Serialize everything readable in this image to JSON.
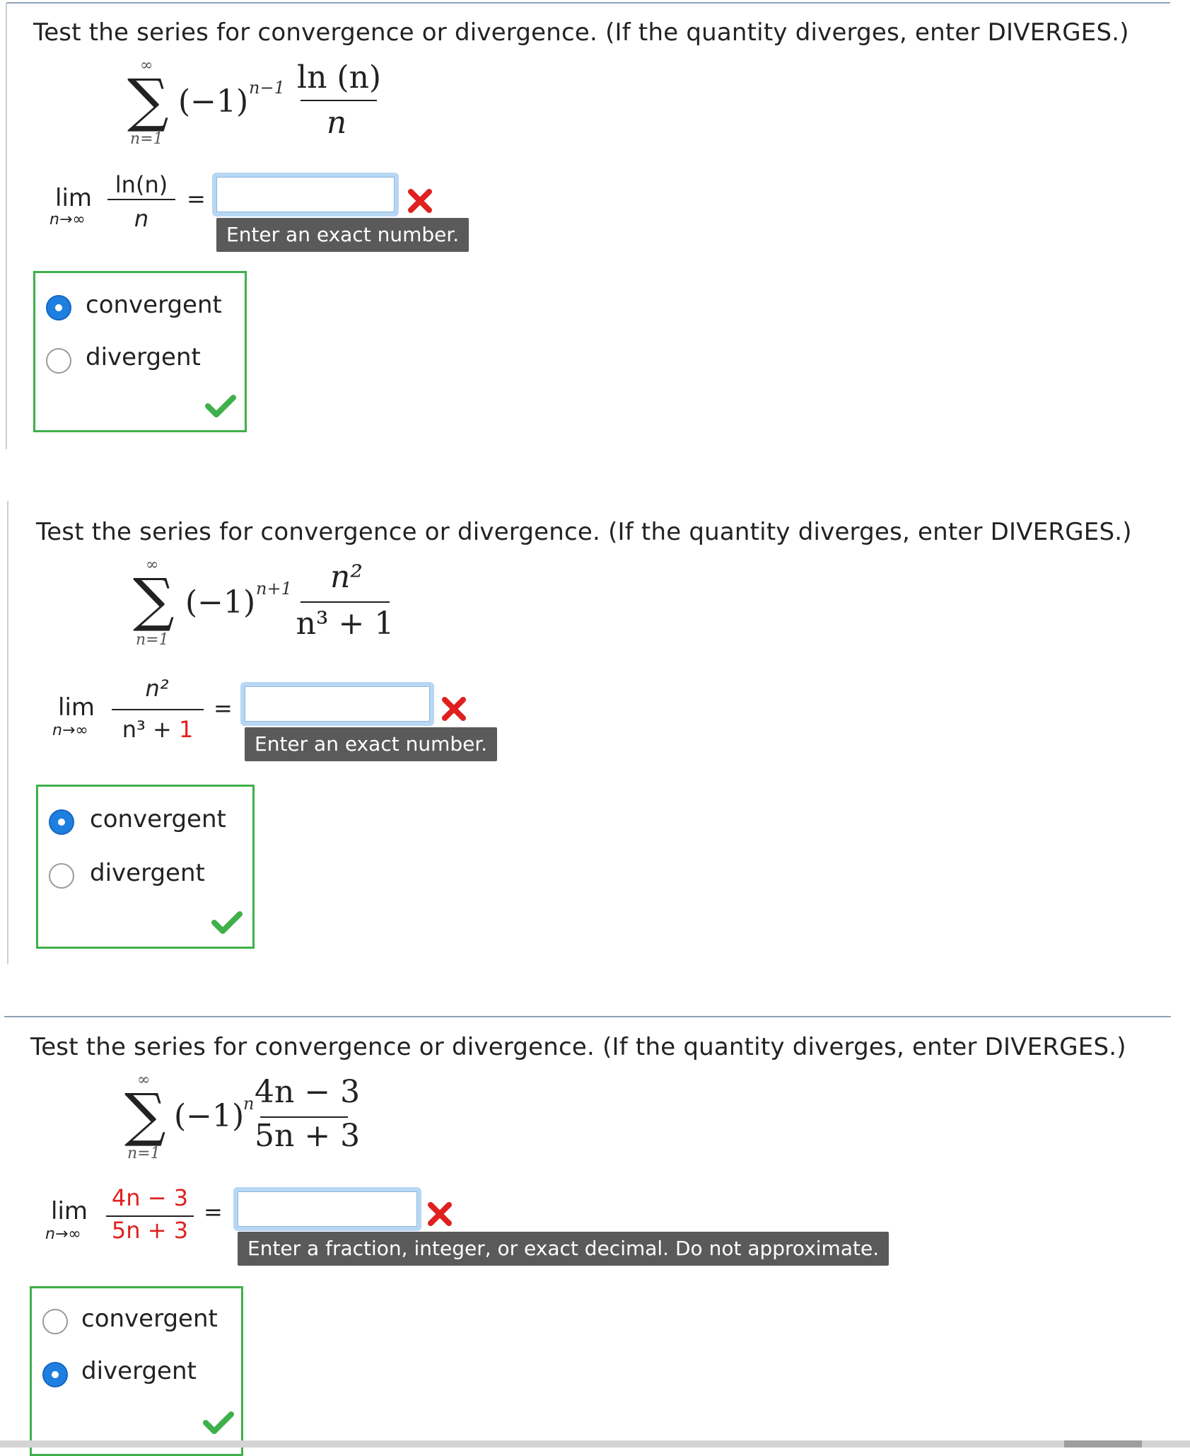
{
  "problems": [
    {
      "prompt": "Test the series for convergence or divergence. (If the quantity diverges, enter DIVERGES.)",
      "sum_upper": "∞",
      "sum_lower": "n=1",
      "sign_base": "(−1)",
      "sign_exponent": "n−1",
      "term_numerator": "ln (n)",
      "term_denominator": "n",
      "limit_word": "lim",
      "limit_sub": "n→∞",
      "limit_numerator": "ln(n)",
      "limit_denominator": "n",
      "equals": "=",
      "answer_value": "",
      "hint": "Enter an exact number.",
      "options": [
        "convergent",
        "divergent"
      ],
      "selected": "convergent",
      "answer_status": "incorrect",
      "choice_status": "correct"
    },
    {
      "prompt": "Test the series for convergence or divergence. (If the quantity diverges, enter DIVERGES.)",
      "sum_upper": "∞",
      "sum_lower": "n=1",
      "sign_base": "(−1)",
      "sign_exponent": "n+1",
      "term_numerator": "n²",
      "term_denominator": "n³ + 1",
      "limit_word": "lim",
      "limit_sub": "n→∞",
      "limit_numerator": "n²",
      "limit_denominator_main": "n³ +",
      "limit_denominator_red": "1",
      "equals": "=",
      "answer_value": "",
      "hint": "Enter an exact number.",
      "options": [
        "convergent",
        "divergent"
      ],
      "selected": "convergent",
      "answer_status": "incorrect",
      "choice_status": "correct"
    },
    {
      "prompt": "Test the series for convergence or divergence. (If the quantity diverges, enter DIVERGES.)",
      "sum_upper": "∞",
      "sum_lower": "n=1",
      "sign_base": "(−1)",
      "sign_exponent": "n",
      "term_numerator": "4n − 3",
      "term_denominator": "5n + 3",
      "limit_word": "lim",
      "limit_sub": "n→∞",
      "limit_numerator": "4n − 3",
      "limit_denominator": "5n + 3",
      "equals": "=",
      "answer_value": "",
      "hint": "Enter a fraction, integer, or exact decimal. Do not approximate.",
      "options": [
        "convergent",
        "divergent"
      ],
      "selected": "divergent",
      "answer_status": "incorrect",
      "choice_status": "correct"
    }
  ],
  "colors": {
    "correct": "#3fb04a",
    "incorrect": "#e02020",
    "radio_selected": "#1f7fe0",
    "hint_background": "#5a5a5a",
    "input_border": "#b7d7f3"
  },
  "icons": {
    "incorrect": "red-x-icon",
    "correct": "green-check-icon"
  }
}
